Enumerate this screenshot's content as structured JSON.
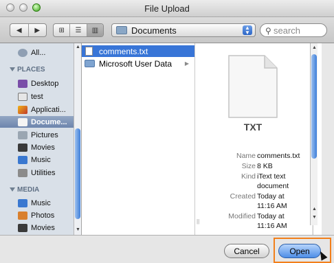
{
  "window": {
    "title": "File Upload"
  },
  "toolbar": {
    "location": "Documents",
    "search_placeholder": "search"
  },
  "sidebar": {
    "top_items": [
      {
        "label": "All...",
        "icon": "network-globe-icon"
      }
    ],
    "places_header": "PLACES",
    "places": [
      {
        "label": "Desktop",
        "icon": "desktop-icon"
      },
      {
        "label": "test",
        "icon": "home-icon"
      },
      {
        "label": "Applicati...",
        "icon": "applications-icon"
      },
      {
        "label": "Docume...",
        "icon": "documents-icon",
        "selected": true
      },
      {
        "label": "Pictures",
        "icon": "pictures-icon"
      },
      {
        "label": "Movies",
        "icon": "movies-icon"
      },
      {
        "label": "Music",
        "icon": "music-icon"
      },
      {
        "label": "Utilities",
        "icon": "utilities-icon"
      }
    ],
    "media_header": "MEDIA",
    "media": [
      {
        "label": "Music",
        "icon": "music-icon"
      },
      {
        "label": "Photos",
        "icon": "photos-icon"
      },
      {
        "label": "Movies",
        "icon": "movies-icon"
      }
    ]
  },
  "browser": {
    "column1": [
      {
        "label": "comments.txt",
        "kind": "file",
        "selected": true
      },
      {
        "label": "Microsoft User Data",
        "kind": "folder"
      }
    ]
  },
  "preview": {
    "icon_label": "TXT",
    "labels": {
      "name": "Name",
      "size": "Size",
      "kind": "Kind",
      "created": "Created",
      "modified": "Modified"
    },
    "values": {
      "name": "comments.txt",
      "size": "8 KB",
      "kind_line1": "iText text",
      "kind_line2": "document",
      "created_line1": "Today at",
      "created_line2": "11:16 AM",
      "modified_line1": "Today at",
      "modified_line2": "11:16 AM"
    }
  },
  "buttons": {
    "cancel": "Cancel",
    "open": "Open"
  },
  "colors": {
    "selection": "#3875d7",
    "highlight": "#f27f1a"
  }
}
